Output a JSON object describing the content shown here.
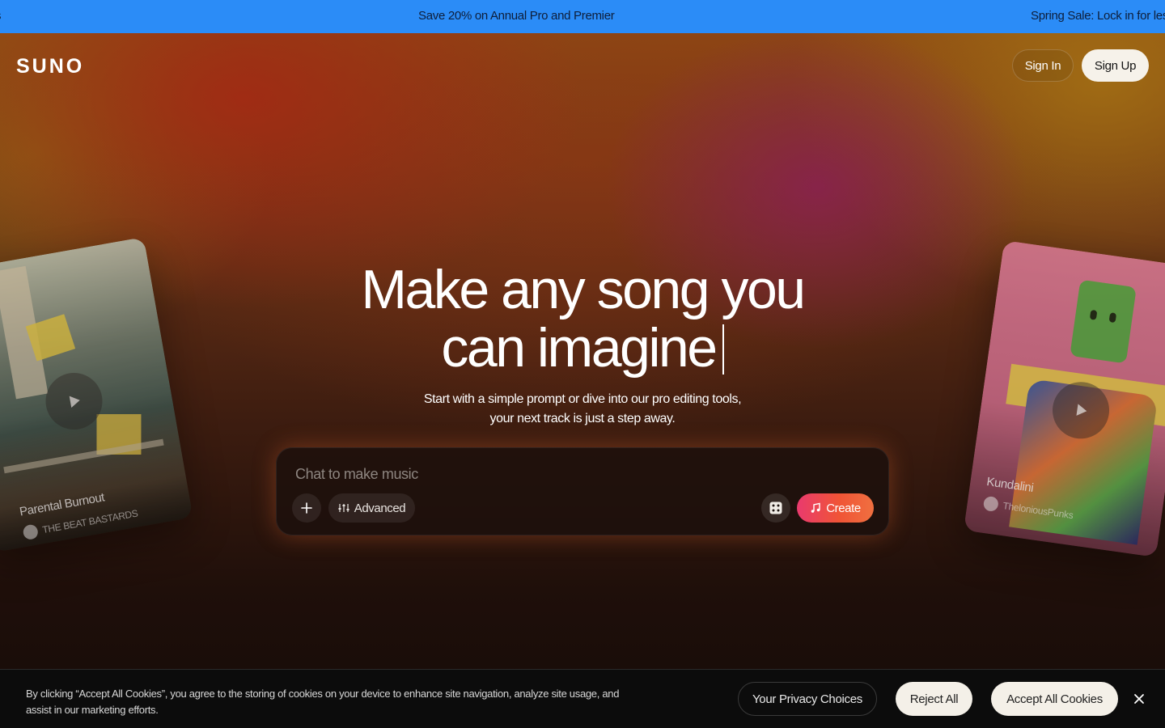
{
  "promo": {
    "left_fragment": "s",
    "middle": "Save 20% on Annual Pro and Premier",
    "right": "Spring Sale: Lock in for les"
  },
  "header": {
    "logo": "SUNO",
    "sign_in": "Sign In",
    "sign_up": "Sign Up"
  },
  "hero": {
    "headline_line1": "Make any song you",
    "headline_line2": "can imagine",
    "subline": "Start with a simple prompt or dive into our pro editing tools, your next track is just a step away."
  },
  "prompt": {
    "placeholder": "Chat to make music",
    "advanced_label": "Advanced",
    "create_label": "Create"
  },
  "cards": {
    "left": {
      "title": "Parental Burnout",
      "artist": "THE BEAT BASTARDS"
    },
    "right": {
      "title": "Kundalini",
      "artist": "TheloniousPunks"
    }
  },
  "cookie": {
    "text": "By clicking “Accept All Cookies”, you agree to the storing of cookies on your device to enhance site navigation, analyze site usage, and assist in our marketing efforts.",
    "privacy_choices": "Your Privacy Choices",
    "reject_all": "Reject All",
    "accept_all": "Accept All Cookies"
  },
  "colors": {
    "promo_bg": "#2b8cf7",
    "create_gradient_start": "#e93a6e",
    "create_gradient_end": "#f07040",
    "cookie_bg": "#0c0c0c"
  },
  "icons": {
    "plus": "plus-icon",
    "advanced": "sliders-icon",
    "dice": "dice-icon",
    "create": "music-note-icon",
    "play": "play-icon",
    "close": "close-icon"
  }
}
